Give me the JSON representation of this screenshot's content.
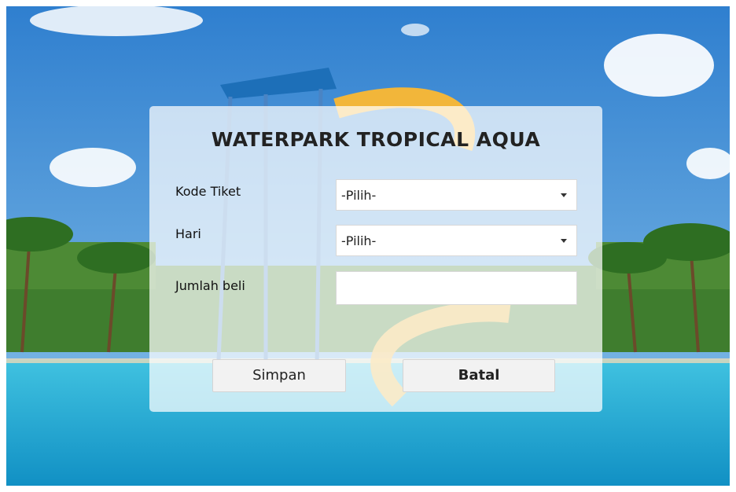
{
  "form": {
    "title": "WATERPARK TROPICAL AQUA",
    "fields": {
      "kode_tiket": {
        "label": "Kode Tiket",
        "value": "-Pilih-"
      },
      "hari": {
        "label": "Hari",
        "value": "-Pilih-"
      },
      "jumlah_beli": {
        "label": "Jumlah beli",
        "value": ""
      }
    },
    "buttons": {
      "simpan": "Simpan",
      "batal": "Batal"
    }
  },
  "colors": {
    "sky": "#3f8fd2",
    "water": "#1fa8cf",
    "panel": "#ffffff",
    "button": "#f2f2f2"
  },
  "icons": [
    "dropdown-caret-icon"
  ]
}
